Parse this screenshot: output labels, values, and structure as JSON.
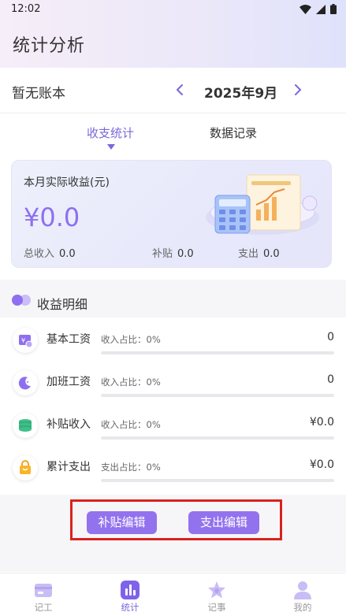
{
  "status_bar": {
    "time": "12:02"
  },
  "app": {
    "title": "统计分析"
  },
  "book": {
    "name": "暂无账本",
    "month": "2025年9月"
  },
  "tabs": [
    {
      "label": "收支统计",
      "active": true
    },
    {
      "label": "数据记录",
      "active": false
    }
  ],
  "summary": {
    "title": "本月实际收益(元)",
    "amount": "¥0.0",
    "income_label": "总收入",
    "income_value": "0.0",
    "subsidy_label": "补贴",
    "subsidy_value": "0.0",
    "expense_label": "支出",
    "expense_value": "0.0"
  },
  "section": {
    "title": "收益明细"
  },
  "details": [
    {
      "label": "基本工资",
      "ratio": "收入占比：0%",
      "value": "0",
      "fraction": 0,
      "icon": "salary-icon"
    },
    {
      "label": "加班工资",
      "ratio": "收入占比：0%",
      "value": "0",
      "fraction": 0,
      "icon": "moon-icon"
    },
    {
      "label": "补贴收入",
      "ratio": "收入占比：0%",
      "value": "¥0.0",
      "fraction": 0,
      "icon": "coins-icon"
    },
    {
      "label": "累计支出",
      "ratio": "支出占比：0%",
      "value": "¥0.0",
      "fraction": 0,
      "icon": "shopping-bag-icon"
    }
  ],
  "actions": {
    "subsidy_edit": "补贴编辑",
    "expense_edit": "支出编辑"
  },
  "nav": [
    {
      "label": "记工",
      "icon": "card-icon",
      "active": false
    },
    {
      "label": "统计",
      "icon": "bar-chart-icon",
      "active": true
    },
    {
      "label": "记事",
      "icon": "star-icon",
      "active": false
    },
    {
      "label": "我的",
      "icon": "person-icon",
      "active": false
    }
  ],
  "colors": {
    "accent": "#8d6ff0",
    "highlight": "#d9221f"
  }
}
